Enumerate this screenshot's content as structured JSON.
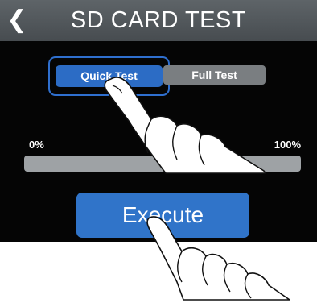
{
  "header": {
    "back_icon": "chevron-left-icon",
    "title": "SD CARD TEST"
  },
  "mode_selector": {
    "options": [
      "Quick Test",
      "Full Test"
    ],
    "selected": "Quick Test"
  },
  "progress": {
    "min_label": "0%",
    "max_label": "100%",
    "value": 0
  },
  "execute_button": {
    "label": "Execute"
  },
  "colors": {
    "accent": "#2c6cc5",
    "header": "#52585c",
    "background": "#050505"
  }
}
